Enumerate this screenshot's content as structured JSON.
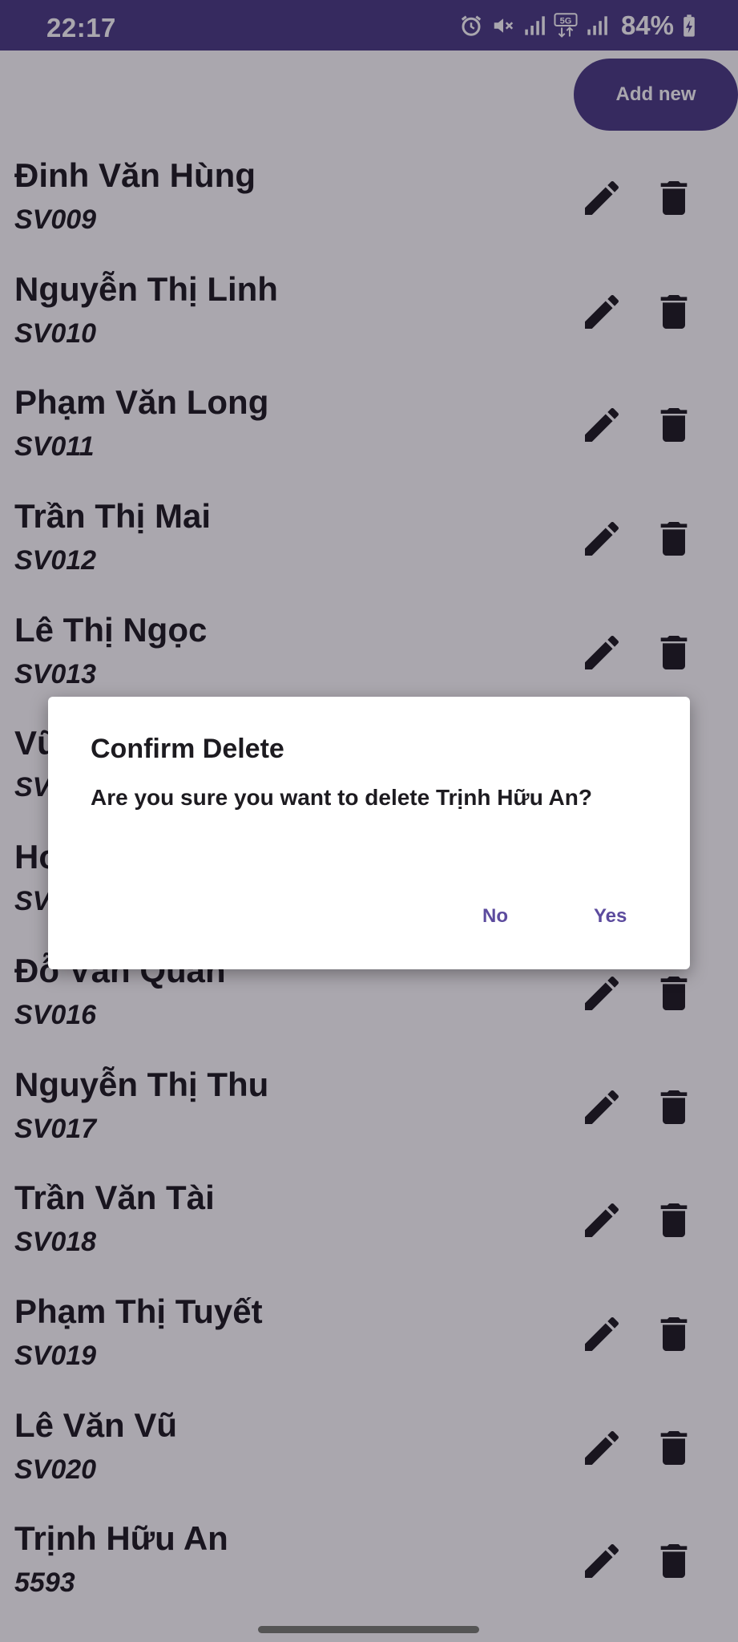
{
  "status_bar": {
    "time": "22:17",
    "battery": "84%",
    "icons": [
      "alarm-icon",
      "mute-icon",
      "signal-icon",
      "5g-icon",
      "signal-icon",
      "battery-charging-icon"
    ]
  },
  "toolbar": {
    "add_label": "Add new"
  },
  "students": [
    {
      "name": "Đinh Văn Hùng",
      "id": "SV009"
    },
    {
      "name": "Nguyễn Thị Linh",
      "id": "SV010"
    },
    {
      "name": "Phạm Văn Long",
      "id": "SV011"
    },
    {
      "name": "Trần Thị Mai",
      "id": "SV012"
    },
    {
      "name": "Lê Thị Ngọc",
      "id": "SV013"
    },
    {
      "name": "Vũ",
      "id": "SV"
    },
    {
      "name": "Ho",
      "id": "SV"
    },
    {
      "name": "Đỗ Văn Quân",
      "id": "SV016"
    },
    {
      "name": "Nguyễn Thị Thu",
      "id": "SV017"
    },
    {
      "name": "Trần Văn Tài",
      "id": "SV018"
    },
    {
      "name": "Phạm Thị Tuyết",
      "id": "SV019"
    },
    {
      "name": "Lê Văn Vũ",
      "id": "SV020"
    },
    {
      "name": "Trịnh Hữu An",
      "id": "5593"
    }
  ],
  "dialog": {
    "title": "Confirm Delete",
    "message": "Are you sure you want to delete Trịnh Hữu An?",
    "no_label": "No",
    "yes_label": "Yes"
  },
  "colors": {
    "primary": "#4a3c84",
    "dialog_button": "#5c4b9e",
    "scrim": "rgba(20,10,30,0.36)"
  }
}
